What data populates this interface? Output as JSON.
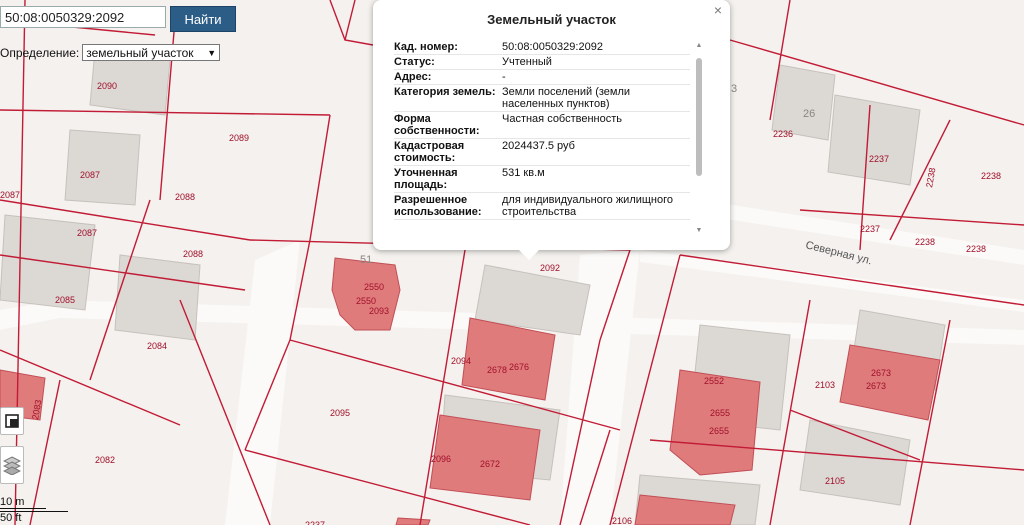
{
  "search": {
    "value": "50:08:0050329:2092",
    "button": "Найти"
  },
  "definition": {
    "label": "Определение:",
    "selected": "земельный участок"
  },
  "popup": {
    "title": "Земельный участок",
    "close": "×",
    "rows": [
      {
        "key": "Кад. номер:",
        "value": "50:08:0050329:2092"
      },
      {
        "key": "Статус:",
        "value": "Учтенный"
      },
      {
        "key": "Адрес:",
        "value": "-"
      },
      {
        "key": "Категория земель:",
        "value": "Земли поселений (земли населенных пунктов)"
      },
      {
        "key": "Форма собственности:",
        "value": "Частная собственность"
      },
      {
        "key": "Кадастровая стоимость:",
        "value": "2024437.5 руб"
      },
      {
        "key": "Уточненная площадь:",
        "value": "531 кв.м"
      },
      {
        "key": "Разрешенное использование:",
        "value": "для индивидуального жилищного строительства"
      }
    ]
  },
  "map": {
    "street": "Северная ул.",
    "house_numbers": [
      "51",
      "26",
      "3"
    ],
    "parcels": [
      "2090",
      "2089",
      "2087",
      "2087",
      "2088",
      "2087",
      "2088",
      "2085",
      "2084",
      "2083",
      "2082",
      "2095",
      "2094",
      "2092",
      "2093",
      "2550",
      "2550",
      "2678",
      "2676",
      "2096",
      "2672",
      "2236",
      "2237",
      "2238",
      "2238",
      "2238",
      "2238",
      "2237",
      "2552",
      "2655",
      "2655",
      "2103",
      "2673",
      "2673",
      "2105",
      "2106",
      "2237"
    ]
  },
  "scale": {
    "m": "10 m",
    "ft": "50 ft"
  },
  "icons": {
    "fullscreen": "fullscreen-icon",
    "layers": "layers-icon"
  }
}
